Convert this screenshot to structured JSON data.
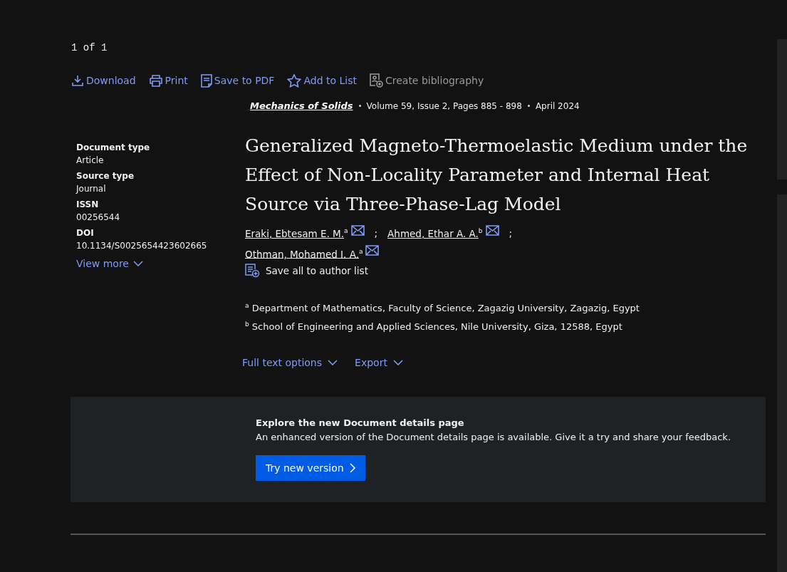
{
  "pager": "1 of 1",
  "toolbar": [
    {
      "kind": "download",
      "label": "Download",
      "disabled": false
    },
    {
      "kind": "print",
      "label": "Print",
      "disabled": false
    },
    {
      "kind": "pdf",
      "label": "Save to PDF",
      "disabled": false
    },
    {
      "kind": "star",
      "label": "Add to List",
      "disabled": false
    },
    {
      "kind": "bibliography",
      "label": "Create bibliography",
      "disabled": true
    }
  ],
  "source": {
    "journal": "Mechanics of Solids",
    "details": [
      "Volume 59, Issue 2, Pages 885 - 898",
      "April 2024"
    ]
  },
  "details": [
    {
      "label": "Document type",
      "value": "Article"
    },
    {
      "label": "Source type",
      "value": "Journal"
    },
    {
      "label": "ISSN",
      "value": "00256544"
    },
    {
      "label": "DOI",
      "value": "10.1134/S0025654423602665"
    }
  ],
  "view_more": "View more",
  "title": "Generalized Magneto-Thermoelastic Medium under the Effect of Non-Locality Parameter and Internal Heat Source via Three-Phase-Lag Model",
  "authors": [
    {
      "name": "Eraki, Ebtesam E. M.",
      "mark": "a",
      "separator": ";"
    },
    {
      "name": "Ahmed, Ethar A. A.",
      "mark": "b",
      "separator": ";"
    },
    {
      "name": "Othman, Mohamed I. A.",
      "mark": "a"
    }
  ],
  "save_authors": "Save all to author list",
  "affiliations": [
    {
      "mark": "a",
      "text": "Department of Mathematics, Faculty of Science, Zagazig University, Zagazig, Egypt"
    },
    {
      "mark": "b",
      "text": "School of Engineering and Applied Sciences, Nile University, Giza, 12588, Egypt"
    }
  ],
  "actions": [
    "Full text options",
    "Export"
  ],
  "banner": {
    "heading": "Explore the new Document details page",
    "text": "An enhanced version of the Document details page is available. Give it a try and share your feedback.",
    "button": "Try new version"
  }
}
